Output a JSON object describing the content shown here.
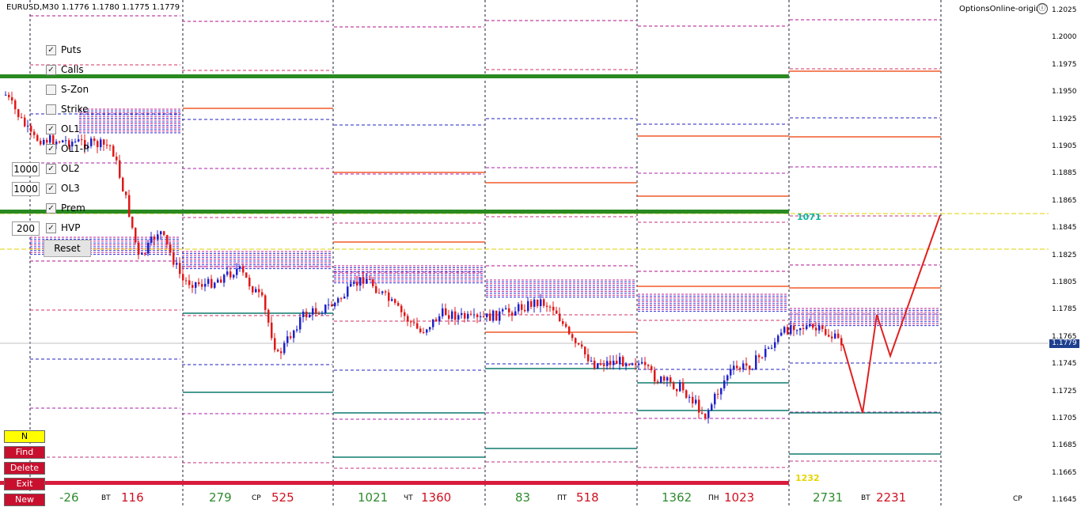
{
  "window": {
    "symbol_line": "EURUSD,M30 1.1776 1.1780 1.1775 1.1779",
    "brand": "OptionsOnline-original",
    "brand_icon": "ⓘ"
  },
  "price_axis": {
    "ticks": [
      "1.2025",
      "1.2000",
      "1.1975",
      "1.1950",
      "1.1925",
      "1.1905",
      "1.1885",
      "1.1865",
      "1.1845",
      "1.1825",
      "1.1805",
      "1.1785",
      "1.1765",
      "1.1745",
      "1.1725",
      "1.1705",
      "1.1685",
      "1.1665",
      "1.1645"
    ],
    "current_price": "1.1779",
    "current_price_color": "#1f3f8f"
  },
  "controls": {
    "checkboxes": [
      {
        "label": "Puts",
        "checked": true
      },
      {
        "label": "Calls",
        "checked": true
      },
      {
        "label": "S-Zon",
        "checked": false
      },
      {
        "label": "Strike",
        "checked": false
      },
      {
        "label": "OL1",
        "checked": true
      },
      {
        "label": "OL1-P",
        "checked": true
      },
      {
        "label": "OL2",
        "checked": true
      },
      {
        "label": "OL3",
        "checked": true
      },
      {
        "label": "Prem",
        "checked": true
      },
      {
        "label": "HVP",
        "checked": true
      }
    ],
    "inputs": [
      "1000",
      "1000",
      "200"
    ],
    "reset_label": "Reset",
    "check_mark": "✓"
  },
  "side_buttons": [
    {
      "label": "N",
      "style": "n"
    },
    {
      "label": "Find",
      "style": "red"
    },
    {
      "label": "Delete",
      "style": "red"
    },
    {
      "label": "Exit",
      "style": "red"
    },
    {
      "label": "New",
      "style": "red"
    }
  ],
  "days": [
    {
      "green": "-26",
      "name": "ВТ",
      "red": "116"
    },
    {
      "green": "279",
      "name": "СР",
      "red": "525"
    },
    {
      "green": "1021",
      "name": "ЧТ",
      "red": "1360"
    },
    {
      "green": "83",
      "name": "ПТ",
      "red": "518"
    },
    {
      "green": "1362",
      "name": "ПН",
      "red": "1023"
    },
    {
      "green": "2731",
      "name": "ВТ",
      "red": "2231"
    }
  ],
  "bottom_cp": "CP",
  "level_labels": {
    "last_day_1071": "1071",
    "last_day_1232": "1232"
  },
  "colors": {
    "green_band": "#2a8a22",
    "red_band": "#d81b3c",
    "candle_up": "#1e22c8",
    "candle_down": "#e01818",
    "teal_level": "#0f7a6e",
    "orange_level": "#f05a2a"
  }
}
